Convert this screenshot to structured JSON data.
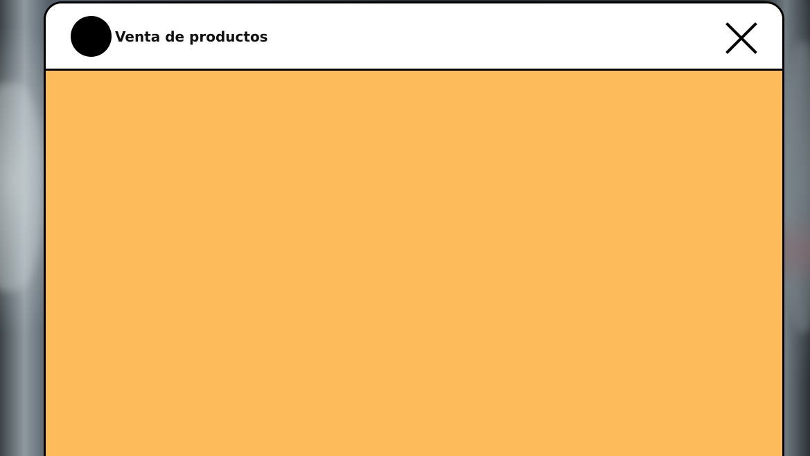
{
  "window": {
    "title": "Venta de productos",
    "close_icon": "close-icon",
    "app_icon": "circle-icon"
  },
  "colors": {
    "content_background": "#fdbb5b",
    "titlebar_background": "#ffffff",
    "border": "#000000"
  }
}
